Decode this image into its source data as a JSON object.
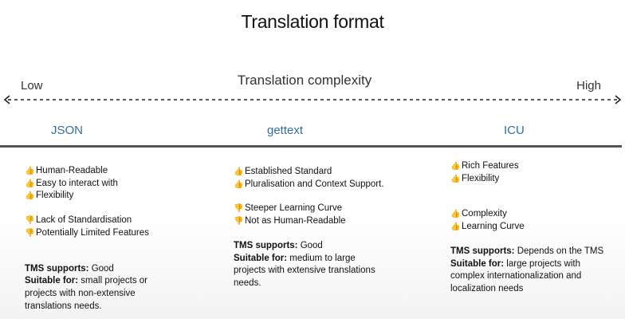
{
  "title": "Translation format",
  "axis": {
    "low": "Low",
    "label": "Translation complexity",
    "high": "High"
  },
  "columns": [
    {
      "heading": "JSON",
      "items": [
        {
          "icon": "thumbs-up",
          "text": "Human-Readable"
        },
        {
          "icon": "none",
          "text": "Easy to interact with"
        },
        {
          "icon": "thumbs-up",
          "text": "Flexibility"
        },
        {
          "icon": "thumbs-down",
          "text": "Lack of Standardisation"
        },
        {
          "icon": "thumbs-down",
          "text": "Potentially Limited Features"
        }
      ],
      "tms_label": "TMS supports:",
      "tms_value": " Good",
      "suitable_label": "Suitable for:",
      "suitable_value": " small projects or projects with non-extensive translations needs."
    },
    {
      "heading": "gettext",
      "items": [
        {
          "icon": "thumbs-up",
          "text": "Established Standard"
        },
        {
          "icon": "thumbs-up",
          "text": "Pluralisation and Context Support."
        },
        {
          "icon": "thumbs-down",
          "text": "Steeper Learning Curve"
        },
        {
          "icon": "thumbs-down",
          "text": "Not as Human-Readable"
        }
      ],
      "tms_label": "TMS supports:",
      "tms_value": " Good",
      "suitable_label": "Suitable for:",
      "suitable_value": " medium to large projects with extensive translations needs."
    },
    {
      "heading": "ICU",
      "items": [
        {
          "icon": "thumbs-up",
          "text": "Rich Features"
        },
        {
          "icon": "thumbs-up",
          "text": "Flexibility"
        },
        {
          "icon": "thumbs-up",
          "text": "Complexity"
        },
        {
          "icon": "thumbs-up",
          "text": "Learning Curve"
        }
      ],
      "tms_label": "TMS supports:",
      "tms_value": " Depends on the TMS",
      "suitable_label": "Suitable for:",
      "suitable_value": " large projects with complex internationalization and localization needs"
    }
  ],
  "colors": {
    "heading": "#2f6fa3",
    "divider": "#555555",
    "thumb": "#e8a317"
  }
}
